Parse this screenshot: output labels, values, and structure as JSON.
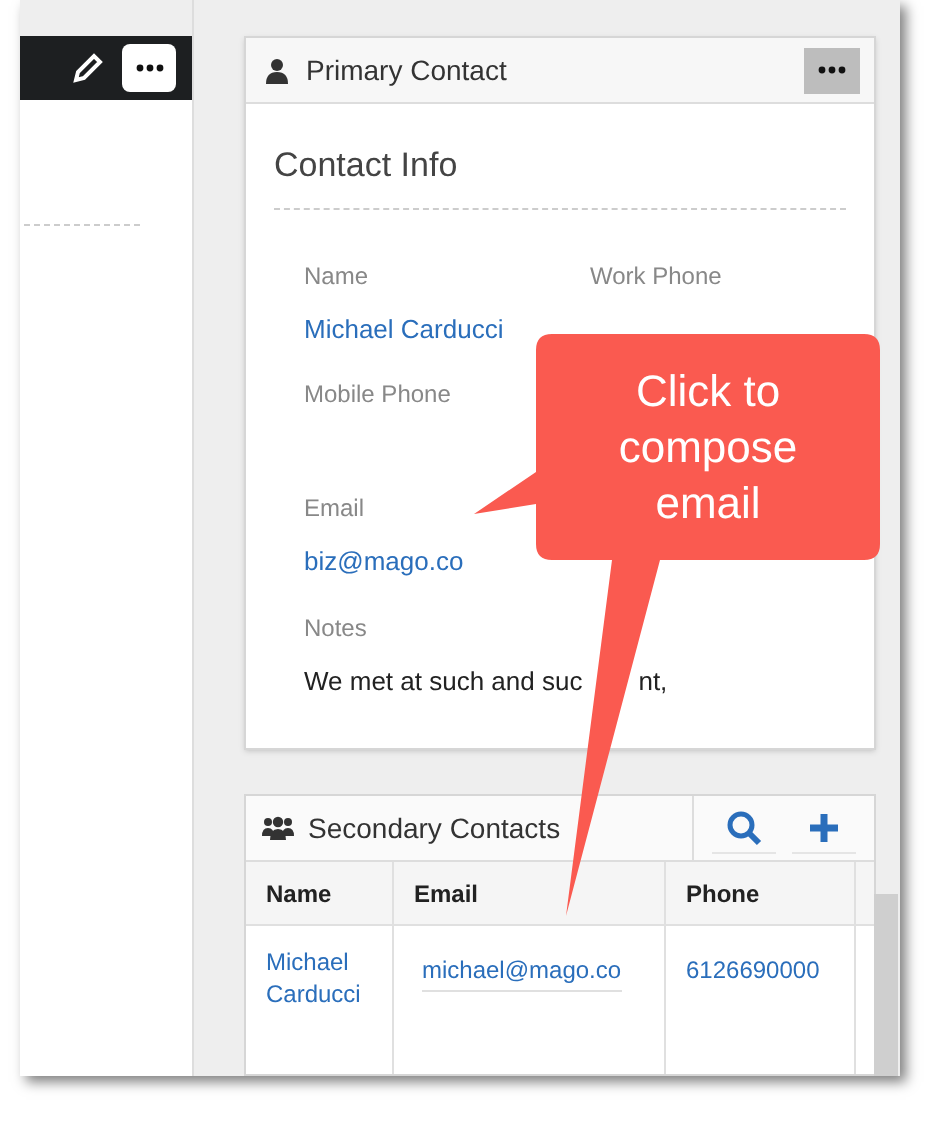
{
  "primary_contact": {
    "title": "Primary Contact",
    "section": "Contact Info",
    "rows": [
      [
        {
          "label": "Name",
          "value": "Michael Carducci"
        },
        {
          "label": "Work Phone"
        }
      ],
      [
        {
          "label": "Mobile Phone"
        }
      ],
      [
        {
          "label": "Email",
          "value": "biz@mago.co"
        }
      ],
      [
        {
          "label": "Notes",
          "value_fragments": [
            "We met at such and suc",
            "nt,"
          ]
        }
      ]
    ]
  },
  "callout": {
    "text": "Click to compose email"
  },
  "secondary_contacts": {
    "title": "Secondary Contacts",
    "columns": [
      "Name",
      "Email",
      "Phone"
    ],
    "rows": [
      {
        "cells": [
          "Michael Carducci",
          "michael@mago.co",
          "6126690000"
        ]
      }
    ]
  }
}
